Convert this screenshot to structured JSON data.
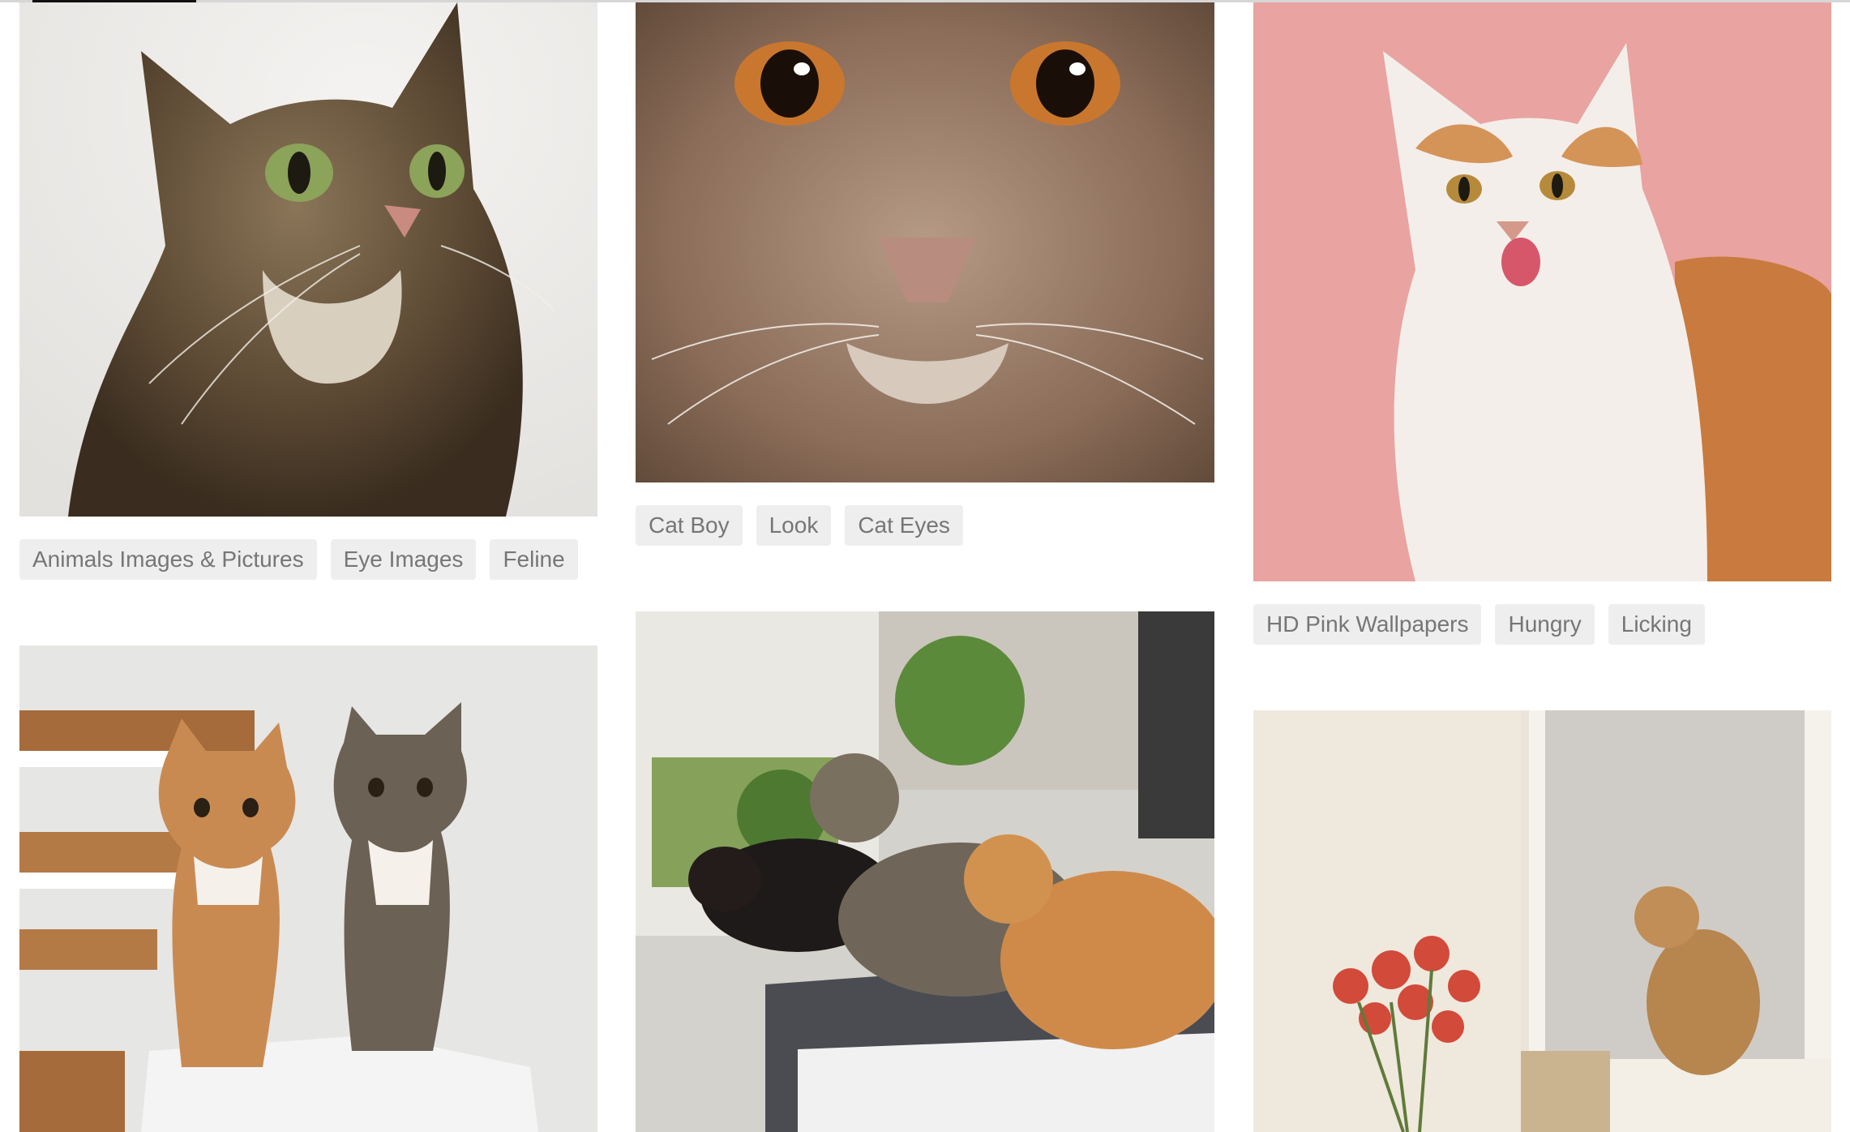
{
  "gallery": {
    "photos": [
      {
        "name": "tabby cat looking up on white background",
        "tags": [
          "Animals Images & Pictures",
          "Eye Images",
          "Feline"
        ]
      },
      {
        "name": "close-up of a brown cat face with orange eyes",
        "tags": [
          "Cat Boy",
          "Look",
          "Cat Eyes"
        ]
      },
      {
        "name": "white and orange cat licking lips on pink background",
        "tags": [
          "HD Pink Wallpapers",
          "Hungry",
          "Licking"
        ]
      },
      {
        "name": "two kittens sitting on a box by stairs",
        "tags": []
      },
      {
        "name": "three cats looking out a window",
        "tags": []
      },
      {
        "name": "cat sitting on books by a snowy window with tulips",
        "tags": []
      }
    ]
  },
  "colors": {
    "tag_background": "#eeeeee",
    "tag_text": "#767676",
    "page_background": "#ffffff"
  }
}
